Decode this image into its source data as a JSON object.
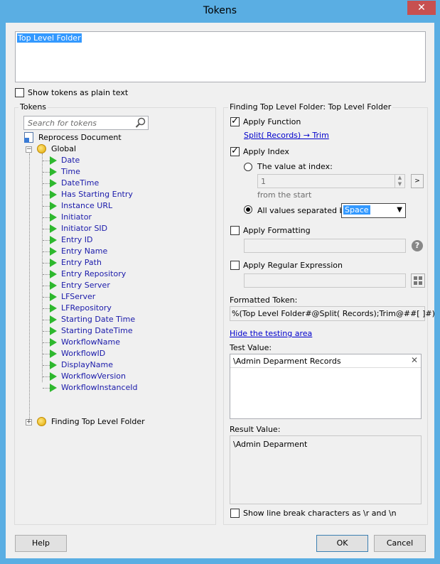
{
  "window": {
    "title": "Tokens",
    "close_glyph": "✕"
  },
  "token_text": "Top Level Folder",
  "show_plain": {
    "label": "Show tokens as plain text",
    "checked": false
  },
  "tokens_panel": {
    "title": "Tokens",
    "search_placeholder": "Search for tokens",
    "root": "Reprocess Document",
    "global": "Global",
    "items": [
      "Date",
      "Time",
      "DateTime",
      "Has Starting Entry",
      "Instance URL",
      "Initiator",
      "Initiator SID",
      "Entry ID",
      "Entry Name",
      "Entry Path",
      "Entry Repository",
      "Entry Server",
      "LFServer",
      "LFRepository",
      "Starting Date Time",
      "Starting DateTime",
      "WorkflowName",
      "WorkflowID",
      "DisplayName",
      "WorkflowVersion",
      "WorkflowInstanceId"
    ],
    "finding": "Finding Top Level Folder"
  },
  "right_panel": {
    "title": "Finding Top Level Folder: Top Level Folder",
    "apply_function": {
      "label": "Apply Function",
      "checked": true,
      "link": "Split( Records) → Trim"
    },
    "apply_index": {
      "label": "Apply Index",
      "checked": true
    },
    "value_at_index": {
      "label": "The value at index:",
      "value": "1",
      "hint": "from the  start",
      "go": ">"
    },
    "all_values": {
      "label": "All values separated by:",
      "selected": "Space"
    },
    "apply_formatting": {
      "label": "Apply Formatting",
      "checked": false
    },
    "apply_regex": {
      "label": "Apply Regular Expression",
      "checked": false
    },
    "formatted_token": {
      "label": "Formatted Token:",
      "value": "%(Top Level Folder#@Split( Records);Trim@##[ ]#)"
    },
    "hide_testing": "Hide the testing area",
    "test_value": {
      "label": "Test Value:",
      "value": "\\Admin Deparment Records"
    },
    "result_value": {
      "label": "Result Value:",
      "value": "\\Admin Deparment"
    },
    "line_breaks": {
      "label": "Show line break characters as \\r and \\n",
      "checked": false
    }
  },
  "buttons": {
    "help": "Help",
    "ok": "OK",
    "cancel": "Cancel"
  }
}
